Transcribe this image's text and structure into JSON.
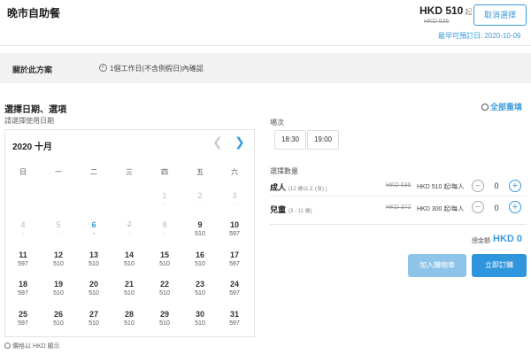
{
  "header": {
    "title": "晚市自助餐",
    "price": "HKD 510",
    "price_unit": "起",
    "original_price": "HKD 636",
    "cancel_label": "取消選擇",
    "earliest_date": "最早可預訂日: 2020-10-09"
  },
  "plan": {
    "label": "關於此方案",
    "confirm_text": "1個工作日(不含例假日)內確認"
  },
  "section": {
    "title": "選擇日期、選項",
    "reset_label": "全部重填",
    "date_hint": "請選擇使用日期"
  },
  "calendar": {
    "title": "2020 十月",
    "weekdays": [
      "日",
      "一",
      "二",
      "三",
      "四",
      "五",
      "六"
    ],
    "weeks": [
      [
        null,
        null,
        null,
        null,
        {
          "d": "1",
          "p": "-",
          "s": "dis"
        },
        {
          "d": "2",
          "p": "-",
          "s": "dis"
        },
        {
          "d": "3",
          "p": "-",
          "s": "dis"
        }
      ],
      [
        {
          "d": "4",
          "p": "-",
          "s": "dis"
        },
        {
          "d": "5",
          "p": "-",
          "s": "dis"
        },
        {
          "d": "6",
          "p": "-",
          "s": "today"
        },
        {
          "d": "7",
          "p": "-",
          "s": "strike"
        },
        {
          "d": "8",
          "p": "-",
          "s": "dis"
        },
        {
          "d": "9",
          "p": "510",
          "s": ""
        },
        {
          "d": "10",
          "p": "597",
          "s": ""
        }
      ],
      [
        {
          "d": "11",
          "p": "597",
          "s": ""
        },
        {
          "d": "12",
          "p": "510",
          "s": ""
        },
        {
          "d": "13",
          "p": "510",
          "s": ""
        },
        {
          "d": "14",
          "p": "510",
          "s": ""
        },
        {
          "d": "15",
          "p": "510",
          "s": ""
        },
        {
          "d": "16",
          "p": "510",
          "s": ""
        },
        {
          "d": "17",
          "p": "597",
          "s": ""
        }
      ],
      [
        {
          "d": "18",
          "p": "597",
          "s": ""
        },
        {
          "d": "19",
          "p": "510",
          "s": ""
        },
        {
          "d": "20",
          "p": "510",
          "s": ""
        },
        {
          "d": "21",
          "p": "510",
          "s": ""
        },
        {
          "d": "22",
          "p": "510",
          "s": ""
        },
        {
          "d": "23",
          "p": "510",
          "s": ""
        },
        {
          "d": "24",
          "p": "597",
          "s": ""
        }
      ],
      [
        {
          "d": "25",
          "p": "597",
          "s": ""
        },
        {
          "d": "26",
          "p": "510",
          "s": ""
        },
        {
          "d": "27",
          "p": "510",
          "s": ""
        },
        {
          "d": "28",
          "p": "510",
          "s": ""
        },
        {
          "d": "29",
          "p": "510",
          "s": ""
        },
        {
          "d": "30",
          "p": "510",
          "s": ""
        },
        {
          "d": "31",
          "p": "597",
          "s": ""
        }
      ]
    ],
    "footnote": "價格以 HKD 顯示"
  },
  "sessions": {
    "label": "場次",
    "options": [
      "18:30",
      "19:00"
    ]
  },
  "quantity": {
    "label": "選擇數量",
    "rows": [
      {
        "name": "成人",
        "sub": "(12 歲以上 (含) )",
        "old": "HKD 636",
        "price": "HKD 510 起/每人",
        "value": "0"
      },
      {
        "name": "兒童",
        "sub": "(3 - 11 歲)",
        "old": "HKD 372",
        "price": "HKD 300 起/每人",
        "value": "0"
      }
    ]
  },
  "total": {
    "label": "總金額",
    "value": "HKD 0"
  },
  "actions": {
    "cart_label": "加入購物車",
    "book_label": "立即訂購"
  },
  "colors": {
    "accent": "#3a9bdc",
    "button_primary": "#2f95dc",
    "button_light": "#8fc4ea"
  }
}
